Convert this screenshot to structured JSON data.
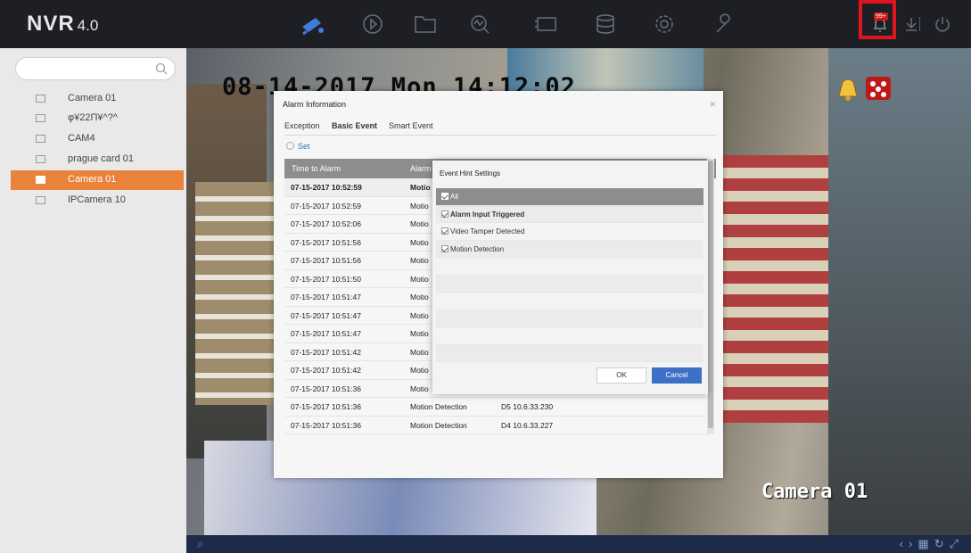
{
  "app": {
    "brand": "NVR",
    "version": "4.0"
  },
  "toolbar": {
    "icons": [
      "live-view-icon",
      "playback-icon",
      "file-management-icon",
      "smart-analysis-icon",
      "configuration-icon",
      "storage-icon",
      "settings-icon",
      "maintenance-icon"
    ],
    "alarm_badge": "99+"
  },
  "sidebar": {
    "search_placeholder": "",
    "cameras": [
      "Camera 01",
      "φ¥22Π¥^?^",
      "CAM4",
      "prague card 01",
      "Camera 01",
      "IPCamera 10"
    ],
    "active_index": 4
  },
  "video": {
    "osd_time": "08-14-2017 Mon 14:12:02",
    "osd_camera": "Camera 01"
  },
  "alarm_dialog": {
    "title": "Alarm Information",
    "tabs": [
      "Exception",
      "Basic Event",
      "Smart Event"
    ],
    "active_tab": "Basic Event",
    "set_label": "Set",
    "columns": [
      "Time to Alarm",
      "Alarm"
    ],
    "rows": [
      {
        "time": "07-15-2017 10:52:59",
        "event": "Motio"
      },
      {
        "time": "07-15-2017 10:52:59",
        "event": "Motio"
      },
      {
        "time": "07-15-2017 10:52:06",
        "event": "Motio"
      },
      {
        "time": "07-15-2017 10:51:56",
        "event": "Motio"
      },
      {
        "time": "07-15-2017 10:51:56",
        "event": "Motio"
      },
      {
        "time": "07-15-2017 10:51:50",
        "event": "Motio"
      },
      {
        "time": "07-15-2017 10:51:47",
        "event": "Motio"
      },
      {
        "time": "07-15-2017 10:51:47",
        "event": "Motio"
      },
      {
        "time": "07-15-2017 10:51:47",
        "event": "Motio"
      },
      {
        "time": "07-15-2017 10:51:42",
        "event": "Motio"
      },
      {
        "time": "07-15-2017 10:51:42",
        "event": "Motio"
      },
      {
        "time": "07-15-2017 10:51:36",
        "event": "Motio",
        "source": ""
      },
      {
        "time": "07-15-2017 10:51:36",
        "event": "Motion Detection",
        "source": "D5 10.6.33.230"
      },
      {
        "time": "07-15-2017 10:51:36",
        "event": "Motion Detection",
        "source": "D4 10.6.33.227"
      }
    ]
  },
  "hint_dialog": {
    "title": "Event Hint Settings",
    "options": [
      {
        "label": "All",
        "checked": true
      },
      {
        "label": "Alarm Input Triggered",
        "checked": true
      },
      {
        "label": "Video Tamper Detected",
        "checked": true
      },
      {
        "label": "Motion Detection",
        "checked": true
      }
    ],
    "ok_label": "OK",
    "cancel_label": "Cancel"
  },
  "colors": {
    "accent": "#e9823a",
    "primary_button": "#3f70c8",
    "alarm_highlight": "#e0141e"
  }
}
